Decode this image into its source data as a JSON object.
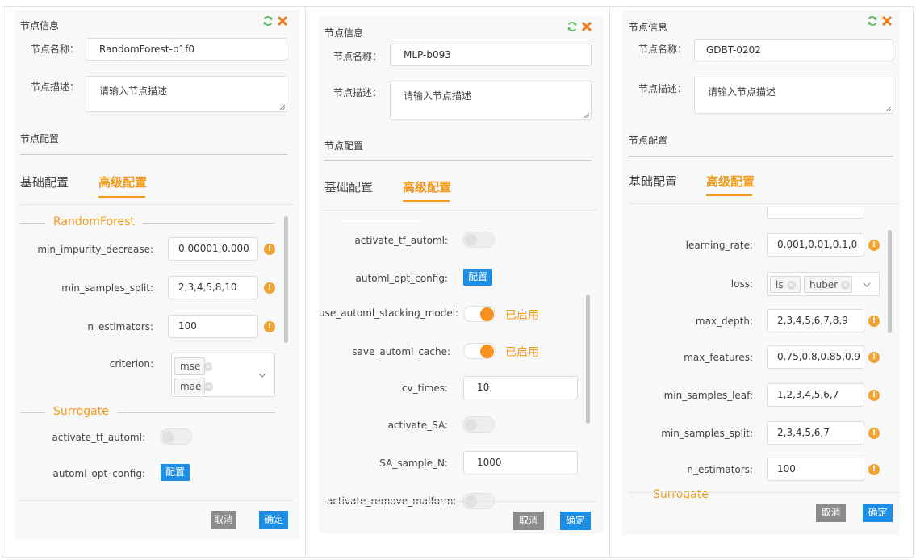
{
  "colors": {
    "accent": "#f49a1b",
    "primary_blue": "#1d8ee6",
    "warning": "#f0a433",
    "panel_bg": "#f8f8f8"
  },
  "panels": [
    {
      "header_title": "节点信息",
      "name_label": "节点名称：",
      "name_value": "RandomForest-b1f0",
      "desc_label": "节点描述：",
      "desc_placeholder": "请输入节点描述",
      "config_section": "节点配置",
      "tab_basic": "基础配置",
      "tab_advanced": "高级配置",
      "group1_title": "RandomForest",
      "params": [
        {
          "label": "min_impurity_decrease:",
          "value": "0.00001,0.000"
        },
        {
          "label": "min_samples_split:",
          "value": "2,3,4,5,8,10"
        },
        {
          "label": "n_estimators:",
          "value": "100"
        }
      ],
      "criterion_label": "criterion:",
      "criterion_tags": [
        "mse",
        "mae"
      ],
      "group2_title": "Surrogate",
      "activate_tf_label": "activate_tf_automl:",
      "automl_opt_label": "automl_opt_config:",
      "config_button": "配置",
      "cancel": "取消",
      "confirm": "确定"
    },
    {
      "header_title": "节点信息",
      "name_label": "节点名称：",
      "name_value": "MLP-b093",
      "desc_label": "节点描述：",
      "desc_placeholder": "请输入节点描述",
      "config_section": "节点配置",
      "tab_basic": "基础配置",
      "tab_advanced": "高级配置",
      "activate_tf_label": "activate_tf_automl:",
      "automl_opt_label": "automl_opt_config:",
      "config_button": "配置",
      "stacking_label": "use_automl_stacking_model:",
      "stacking_status": "已启用",
      "cache_label": "save_automl_cache:",
      "cache_status": "已启用",
      "cv_label": "cv_times:",
      "cv_value": "10",
      "sa_label": "activate_SA:",
      "sa_n_label": "SA_sample_N:",
      "sa_n_value": "1000",
      "malform_label": "activate_remove_malform:",
      "cancel": "取消",
      "confirm": "确定"
    },
    {
      "header_title": "节点信息",
      "name_label": "节点名称：",
      "name_value": "GDBT-0202",
      "desc_label": "节点描述：",
      "desc_placeholder": "请输入节点描述",
      "config_section": "节点配置",
      "tab_basic": "基础配置",
      "tab_advanced": "高级配置",
      "lr_label": "learning_rate:",
      "lr_value": "0.001,0.01,0.1,0",
      "loss_label": "loss:",
      "loss_tags": [
        "ls",
        "huber"
      ],
      "params": [
        {
          "label": "max_depth:",
          "value": "2,3,4,5,6,7,8,9"
        },
        {
          "label": "max_features:",
          "value": "0.75,0.8,0.85,0.9"
        },
        {
          "label": "min_samples_leaf:",
          "value": "1,2,3,4,5,6,7"
        },
        {
          "label": "min_samples_split:",
          "value": "2,3,4,5,6,7"
        },
        {
          "label": "n_estimators:",
          "value": "100"
        }
      ],
      "group2_title": "Surrogate",
      "cancel": "取消",
      "confirm": "确定"
    }
  ]
}
